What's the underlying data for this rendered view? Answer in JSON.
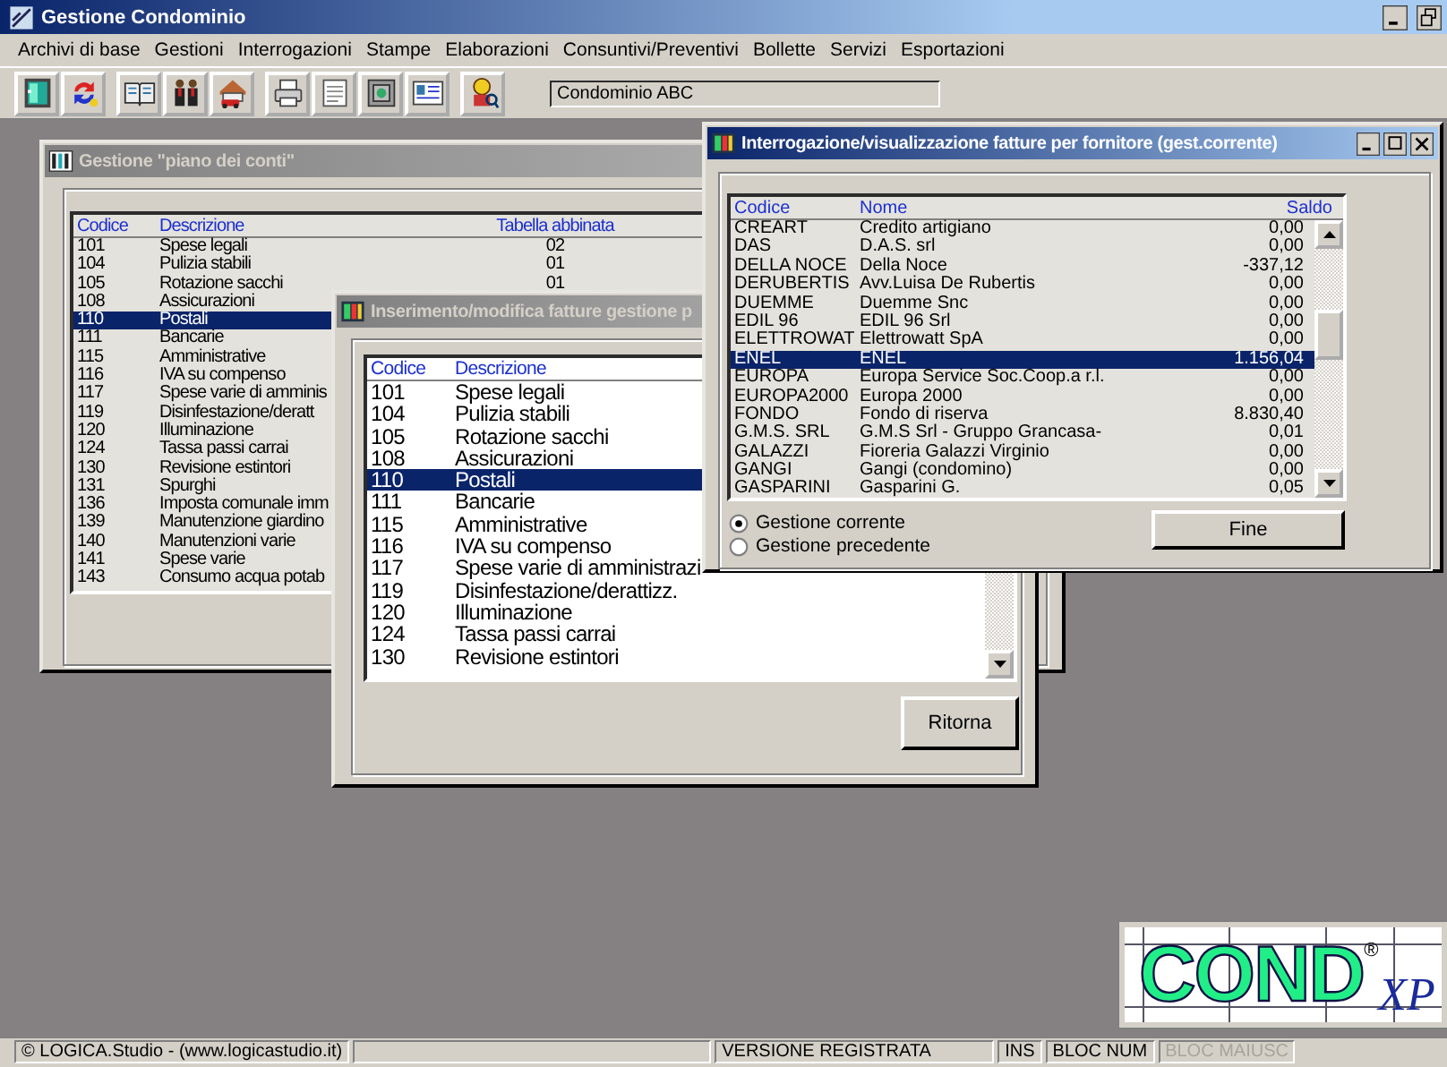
{
  "app": {
    "title": "Gestione Condominio"
  },
  "menu": [
    "Archivi di base",
    "Gestioni",
    "Interrogazioni",
    "Stampe",
    "Elaborazioni",
    "Consuntivi/Preventivi",
    "Bollette",
    "Servizi",
    "Esportazioni"
  ],
  "toolbar": {
    "condominium": "Condominio ABC"
  },
  "windows": [
    {
      "kind": "accounts",
      "title": "Gestione \"piano dei conti\"",
      "active": false,
      "columns": [
        "Codice",
        "Descrizione",
        "Tabella abbinata"
      ],
      "rows": [
        {
          "cells": [
            "101",
            "Spese legali",
            "02"
          ],
          "selected": false
        },
        {
          "cells": [
            "104",
            "Pulizia stabili",
            "01"
          ],
          "selected": false
        },
        {
          "cells": [
            "105",
            "Rotazione sacchi",
            "01"
          ],
          "selected": false
        },
        {
          "cells": [
            "108",
            "Assicurazioni"
          ],
          "selected": false
        },
        {
          "cells": [
            "110",
            "Postali"
          ],
          "selected": true
        },
        {
          "cells": [
            "111",
            "Bancarie"
          ],
          "selected": false
        },
        {
          "cells": [
            "115",
            "Amministrative"
          ],
          "selected": false
        },
        {
          "cells": [
            "116",
            "IVA su compenso"
          ],
          "selected": false
        },
        {
          "cells": [
            "117",
            "Spese varie di amminis"
          ],
          "selected": false
        },
        {
          "cells": [
            "119",
            "Disinfestazione/deratt"
          ],
          "selected": false
        },
        {
          "cells": [
            "120",
            "Illuminazione"
          ],
          "selected": false
        },
        {
          "cells": [
            "124",
            "Tassa passi carrai"
          ],
          "selected": false
        },
        {
          "cells": [
            "130",
            "Revisione estintori"
          ],
          "selected": false
        },
        {
          "cells": [
            "131",
            "Spurghi"
          ],
          "selected": false
        },
        {
          "cells": [
            "136",
            "Imposta comunale imm"
          ],
          "selected": false
        },
        {
          "cells": [
            "139",
            "Manutenzione giardino"
          ],
          "selected": false
        },
        {
          "cells": [
            "140",
            "Manutenzioni varie"
          ],
          "selected": false
        },
        {
          "cells": [
            "141",
            "Spese varie"
          ],
          "selected": false
        },
        {
          "cells": [
            "143",
            "Consumo acqua potab"
          ],
          "selected": false
        }
      ]
    },
    {
      "kind": "invoices",
      "title": "Inserimento/modifica fatture gestione p",
      "active": false,
      "columns": [
        "Codice",
        "Descrizione"
      ],
      "rows": [
        {
          "cells": [
            "101",
            "Spese legali"
          ],
          "selected": false
        },
        {
          "cells": [
            "104",
            "Pulizia stabili"
          ],
          "selected": false
        },
        {
          "cells": [
            "105",
            "Rotazione sacchi"
          ],
          "selected": false
        },
        {
          "cells": [
            "108",
            "Assicurazioni"
          ],
          "selected": false
        },
        {
          "cells": [
            "110",
            "Postali"
          ],
          "selected": true
        },
        {
          "cells": [
            "111",
            "Bancarie"
          ],
          "selected": false
        },
        {
          "cells": [
            "115",
            "Amministrative"
          ],
          "selected": false
        },
        {
          "cells": [
            "116",
            "IVA su compenso"
          ],
          "selected": false
        },
        {
          "cells": [
            "117",
            "Spese varie di amministrazi"
          ],
          "selected": false
        },
        {
          "cells": [
            "119",
            "Disinfestazione/derattizz."
          ],
          "selected": false
        },
        {
          "cells": [
            "120",
            "Illuminazione"
          ],
          "selected": false
        },
        {
          "cells": [
            "124",
            "Tassa passi carrai"
          ],
          "selected": false
        },
        {
          "cells": [
            "130",
            "Revisione estintori"
          ],
          "selected": false
        }
      ],
      "buttons": [
        "Ritorna"
      ]
    },
    {
      "kind": "suppliers",
      "title": "Interrogazione/visualizzazione fatture per fornitore (gest.corrente)",
      "active": true,
      "columns": [
        "Codice",
        "Nome",
        "Saldo"
      ],
      "rows": [
        {
          "cells": [
            "CREART",
            "Credito artigiano",
            "0,00"
          ],
          "selected": false
        },
        {
          "cells": [
            "DAS",
            "D.A.S.  srl",
            "0,00"
          ],
          "selected": false
        },
        {
          "cells": [
            "DELLA NOCE",
            "Della Noce",
            "-337,12"
          ],
          "selected": false
        },
        {
          "cells": [
            "DERUBERTIS",
            "Avv.Luisa De Rubertis",
            "0,00"
          ],
          "selected": false
        },
        {
          "cells": [
            "DUEMME",
            "Duemme Snc",
            "0,00"
          ],
          "selected": false
        },
        {
          "cells": [
            "EDIL 96",
            "EDIL 96 Srl",
            "0,00"
          ],
          "selected": false
        },
        {
          "cells": [
            "ELETTROWAT",
            "Elettrowatt SpA",
            "0,00"
          ],
          "selected": false
        },
        {
          "cells": [
            "ENEL",
            "ENEL",
            "1.156,04"
          ],
          "selected": true
        },
        {
          "cells": [
            "EUROPA",
            "Europa Service Soc.Coop.a r.l.",
            "0,00"
          ],
          "selected": false
        },
        {
          "cells": [
            "EUROPA2000",
            "Europa 2000",
            "0,00"
          ],
          "selected": false
        },
        {
          "cells": [
            "FONDO",
            "Fondo di riserva",
            "8.830,40"
          ],
          "selected": false
        },
        {
          "cells": [
            "G.M.S. SRL",
            "G.M.S Srl - Gruppo Grancasa-",
            "0,01"
          ],
          "selected": false
        },
        {
          "cells": [
            "GALAZZI",
            "Fioreria Galazzi Virginio",
            "0,00"
          ],
          "selected": false
        },
        {
          "cells": [
            "GANGI",
            "Gangi (condomino)",
            "0,00"
          ],
          "selected": false
        },
        {
          "cells": [
            "GASPARINI",
            "Gasparini G.",
            "0,05"
          ],
          "selected": false
        }
      ],
      "options": [
        {
          "label": "Gestione corrente",
          "selected": true
        },
        {
          "label": "Gestione precedente",
          "selected": false
        }
      ],
      "buttons": [
        "Fine"
      ]
    }
  ],
  "logo": {
    "name": "COND",
    "mark": "®",
    "suffix": "XP"
  },
  "status_bar": [
    {
      "text": "© LOGICA.Studio - (www.logicastudio.it)",
      "disabled": false
    },
    {
      "text": "VERSIONE REGISTRATA",
      "disabled": false
    },
    {
      "text": "INS",
      "disabled": false
    },
    {
      "text": "BLOC NUM",
      "disabled": false
    },
    {
      "text": "BLOC MAIUSC",
      "disabled": true
    }
  ]
}
